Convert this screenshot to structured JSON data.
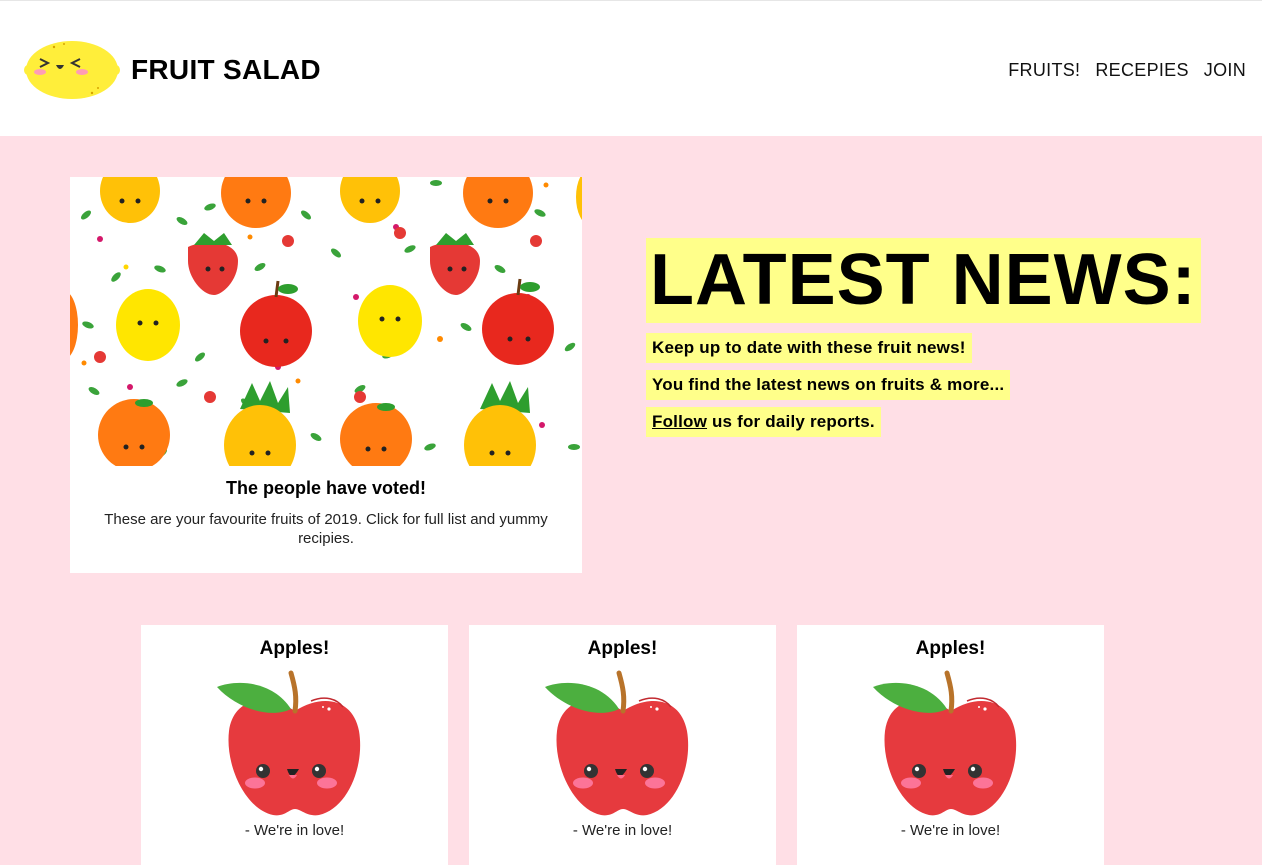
{
  "header": {
    "site_title": "FRUIT SALAD",
    "logo_icon": "lemon-face-icon",
    "nav": [
      "FRUITS!",
      "RECEPIES",
      "JOIN"
    ]
  },
  "hero": {
    "image_icon": "fruit-pattern-illustration",
    "heading": "The people have voted!",
    "text": "These are your favourite fruits of 2019. Click for full list and yummy recipies."
  },
  "news": {
    "title": "LATEST NEWS:",
    "line1": "Keep up to date with these fruit news!",
    "line2": "You find the latest news on fruits & more...",
    "line3_link": "Follow",
    "line3_rest": " us for daily reports."
  },
  "cards": [
    {
      "title": "Apples!",
      "caption": "- We're in love!",
      "icon": "apple-face-icon"
    },
    {
      "title": "Apples!",
      "caption": "- We're in love!",
      "icon": "apple-face-icon"
    },
    {
      "title": "Apples!",
      "caption": "- We're in love!",
      "icon": "apple-face-icon"
    }
  ],
  "colors": {
    "background": "#ffdfe6",
    "highlight": "#ffff8a",
    "apple_red": "#e63a3e",
    "leaf_green": "#4caf3f",
    "lemon_yellow": "#ffee3a"
  }
}
